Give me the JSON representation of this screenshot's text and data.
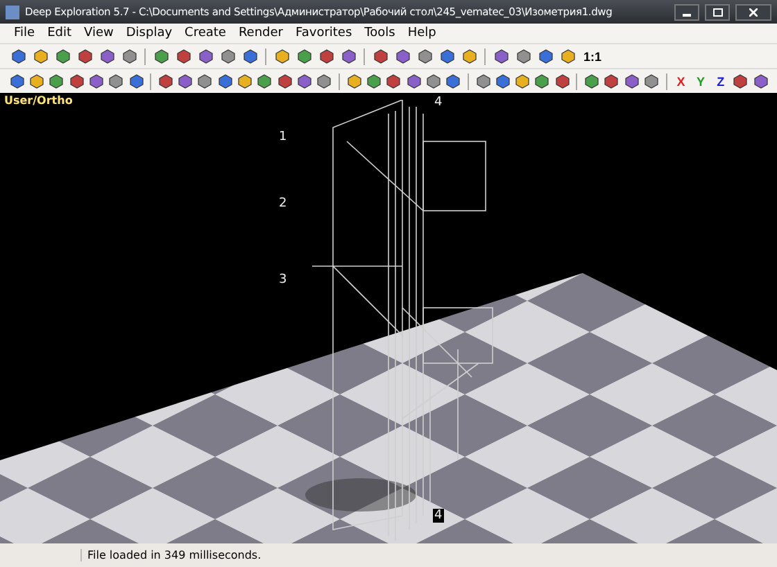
{
  "window": {
    "title": "Deep Exploration 5.7 - C:\\Documents and Settings\\Администратор\\Рабочий стол\\245_vematec_03\\Изометрия1.dwg"
  },
  "menu": [
    "File",
    "Edit",
    "View",
    "Display",
    "Create",
    "Render",
    "Favorites",
    "Tools",
    "Help"
  ],
  "toolbar_1": {
    "zoom_label": "1:1"
  },
  "toolbar_2": {
    "axes": [
      {
        "label": "X",
        "color": "#e02020"
      },
      {
        "label": "Y",
        "color": "#20a020"
      },
      {
        "label": "Z",
        "color": "#2020e0"
      }
    ]
  },
  "viewport": {
    "view_label": "User/Ortho",
    "callouts": [
      "4",
      "1",
      "2",
      "3",
      "4"
    ]
  },
  "status_bar": {
    "message": "File loaded in 349 milliseconds."
  }
}
